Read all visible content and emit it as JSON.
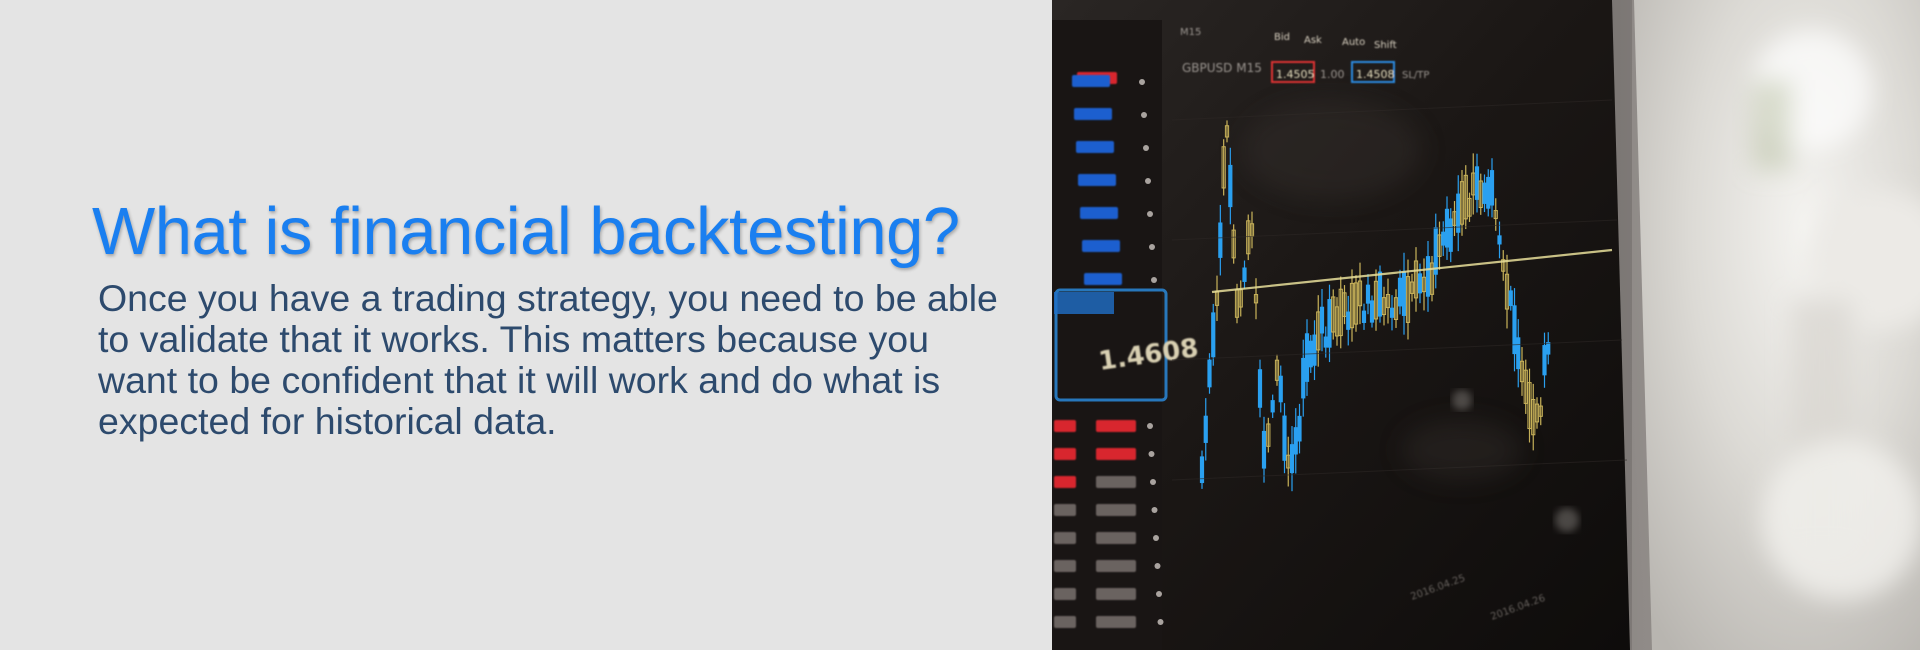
{
  "slide": {
    "heading": "What is financial backtesting?",
    "body": "Once you have a trading strategy, you need to be able to validate that it works. This matters because you want to be confident that it will work and do what is expected for historical data."
  },
  "photo": {
    "subject": "trading-chart-monitor-photo",
    "screen_texts": {
      "symbol": "GBPUSD M15",
      "sell_price": "1.4505",
      "lot": "1.00",
      "buy_price": "1.4508",
      "sltp": "SL/TP",
      "bid_label": "Bid",
      "ask_label": "Ask",
      "auto_label": "Auto",
      "shift_label": "Shift",
      "period_m15": "M15",
      "big_quote": "1.4608"
    }
  },
  "colors": {
    "page_background": "#e4e4e4",
    "heading": "#1a7ff0",
    "body": "#2d4a6d",
    "candle_up": "#2aa0f0",
    "candle_down": "#c9b35a",
    "trend_line": "#e8df9a"
  }
}
